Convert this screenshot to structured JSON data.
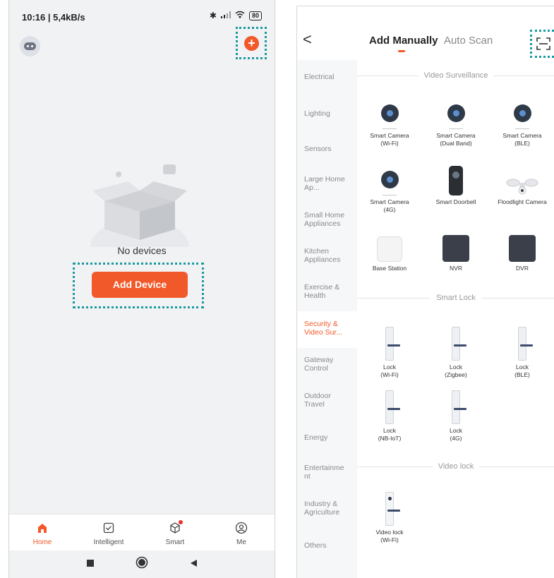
{
  "left": {
    "status": {
      "time": "10:16 | 5,4kB/s",
      "battery": "80"
    },
    "empty_text": "No devices",
    "add_device_label": "Add Device",
    "nav": [
      {
        "label": "Home",
        "icon": "home-icon"
      },
      {
        "label": "Intelligent",
        "icon": "checkbox-icon"
      },
      {
        "label": "Smart",
        "icon": "cube-icon"
      },
      {
        "label": "Me",
        "icon": "user-icon"
      }
    ],
    "colors": {
      "accent": "#f2592a",
      "highlight": "#1a9a9f"
    }
  },
  "right": {
    "tabs": {
      "manual": "Add Manually",
      "auto": "Auto Scan"
    },
    "categories": [
      "Electrical",
      "Lighting",
      "Sensors",
      "Large Home Ap...",
      "Small Home Appliances",
      "Kitchen Appliances",
      "Exercise & Health",
      "Security & Video Sur...",
      "Gateway Control",
      "Outdoor Travel",
      "Energy",
      "Entertainment",
      "Industry & Agriculture",
      "Others"
    ],
    "active_category": "Security & Video Sur...",
    "sections": {
      "video": "Video Surveillance",
      "lock": "Smart Lock",
      "video_lock": "Video lock"
    },
    "video_items": [
      {
        "name": "Smart Camera",
        "sub": "(Wi-Fi)"
      },
      {
        "name": "Smart Camera",
        "sub": "(Dual Band)"
      },
      {
        "name": "Smart Camera",
        "sub": "(BLE)"
      },
      {
        "name": "Smart Camera",
        "sub": "(4G)"
      },
      {
        "name": "Smart Doorbell",
        "sub": ""
      },
      {
        "name": "Floodlight Camera",
        "sub": ""
      },
      {
        "name": "Base Station",
        "sub": ""
      },
      {
        "name": "NVR",
        "sub": ""
      },
      {
        "name": "DVR",
        "sub": ""
      }
    ],
    "lock_items": [
      {
        "name": "Lock",
        "sub": "(Wi-Fi)"
      },
      {
        "name": "Lock",
        "sub": "(Zigbee)"
      },
      {
        "name": "Lock",
        "sub": "(BLE)"
      },
      {
        "name": "Lock",
        "sub": "(NB-IoT)"
      },
      {
        "name": "Lock",
        "sub": "(4G)"
      }
    ],
    "video_lock_items": [
      {
        "name": "Video lock",
        "sub": "(Wi-Fi)"
      }
    ]
  }
}
